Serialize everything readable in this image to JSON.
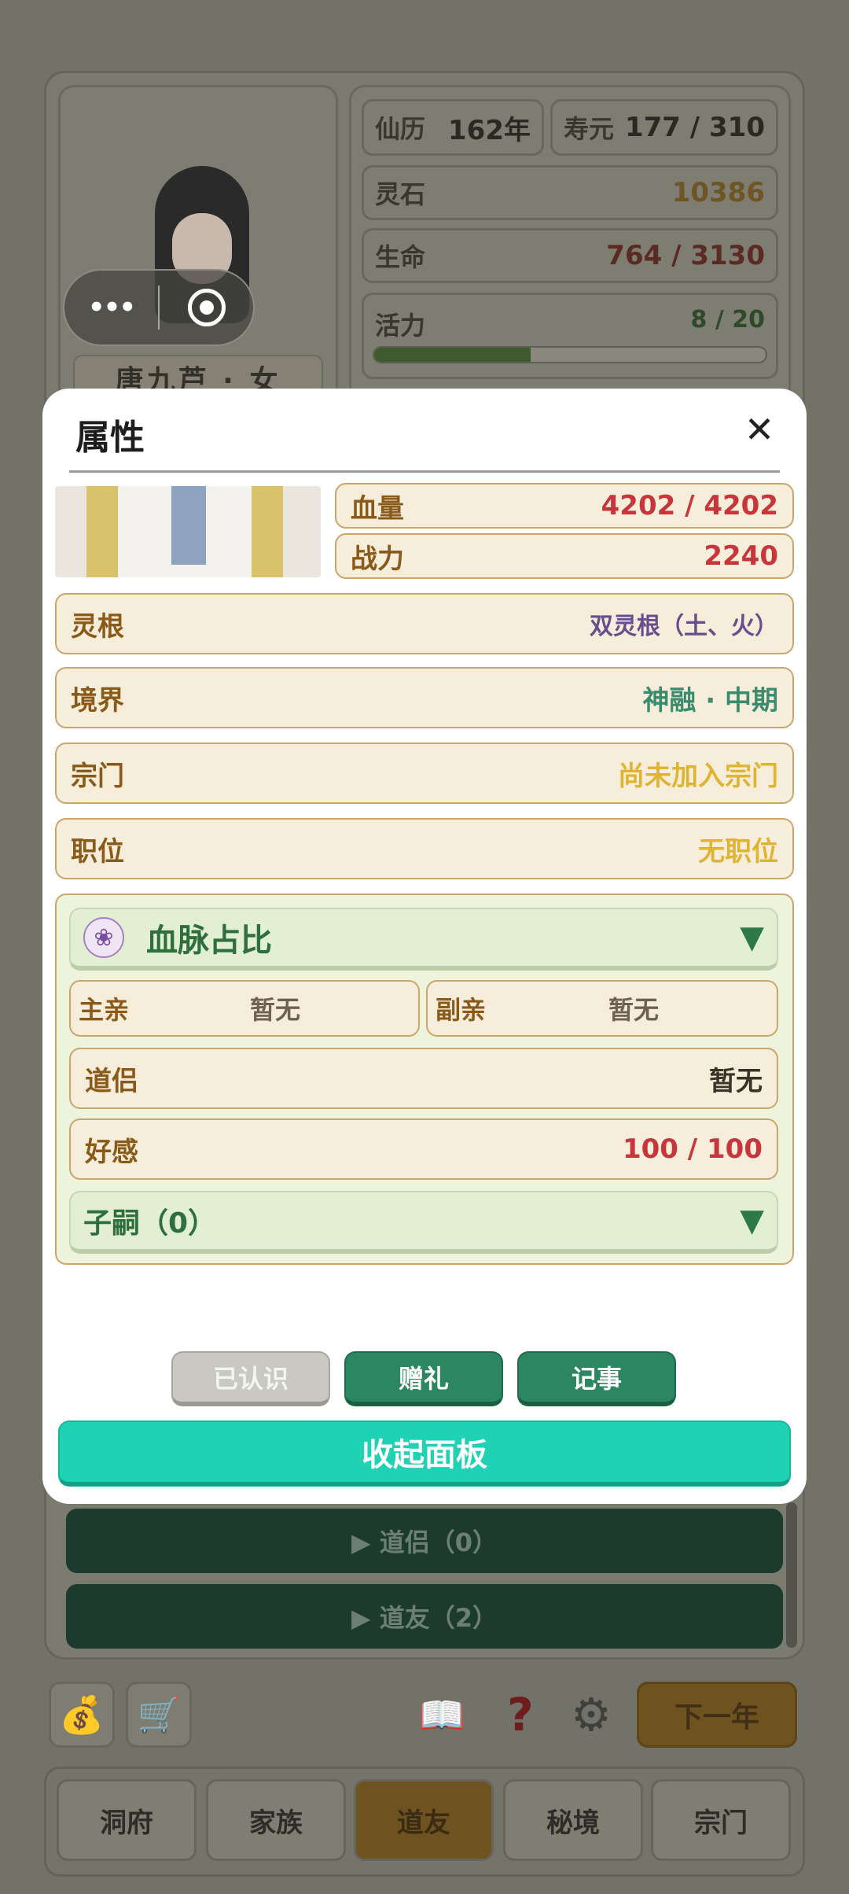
{
  "background": {
    "character_name": "唐九芦 · 女",
    "stats": {
      "calendar_label": "仙历",
      "calendar_value": "162年",
      "lifespan_label": "寿元",
      "lifespan_value": "177 / 310",
      "spirit_stone_label": "灵石",
      "spirit_stone_value": "10386",
      "life_label": "生命",
      "life_value": "764 / 3130",
      "vigor_label": "活力",
      "vigor_value": "8 / 20",
      "vigor_fraction": 0.4
    },
    "friend_sections": [
      "▶ 道侣（0）",
      "▶ 道友（2）"
    ],
    "toolbar": {
      "next_year": "下一年"
    },
    "tabs": [
      "洞府",
      "家族",
      "道友",
      "秘境",
      "宗门"
    ],
    "active_tab": "道友"
  },
  "capsule": {
    "more": "•••"
  },
  "modal": {
    "title": "属性",
    "close": "✕",
    "hp_label": "血量",
    "hp_value": "4202 / 4202",
    "power_label": "战力",
    "power_value": "2240",
    "rows": [
      {
        "label": "灵根",
        "value": "双灵根（土、火）",
        "color": "#6a4d8c"
      },
      {
        "label": "境界",
        "value": "神融 · 中期",
        "color": "#3b8c6e"
      },
      {
        "label": "宗门",
        "value": "尚未加入宗门",
        "color": "#e0b433"
      },
      {
        "label": "职位",
        "value": "无职位",
        "color": "#e0b433"
      }
    ],
    "bloodline": {
      "title": "血脉占比",
      "main_parent_label": "主亲",
      "main_parent_value": "暂无",
      "sub_parent_label": "副亲",
      "sub_parent_value": "暂无",
      "partner_label": "道侣",
      "partner_value": "暂无",
      "affection_label": "好感",
      "affection_value": "100 / 100",
      "children_label": "子嗣（0）"
    },
    "buttons": {
      "known": "已认识",
      "gift": "赠礼",
      "records": "记事",
      "collapse": "收起面板"
    }
  },
  "colors": {
    "accent_teal": "#1fd2b3",
    "accent_green": "#2b8661",
    "value_red": "#c0392b"
  }
}
